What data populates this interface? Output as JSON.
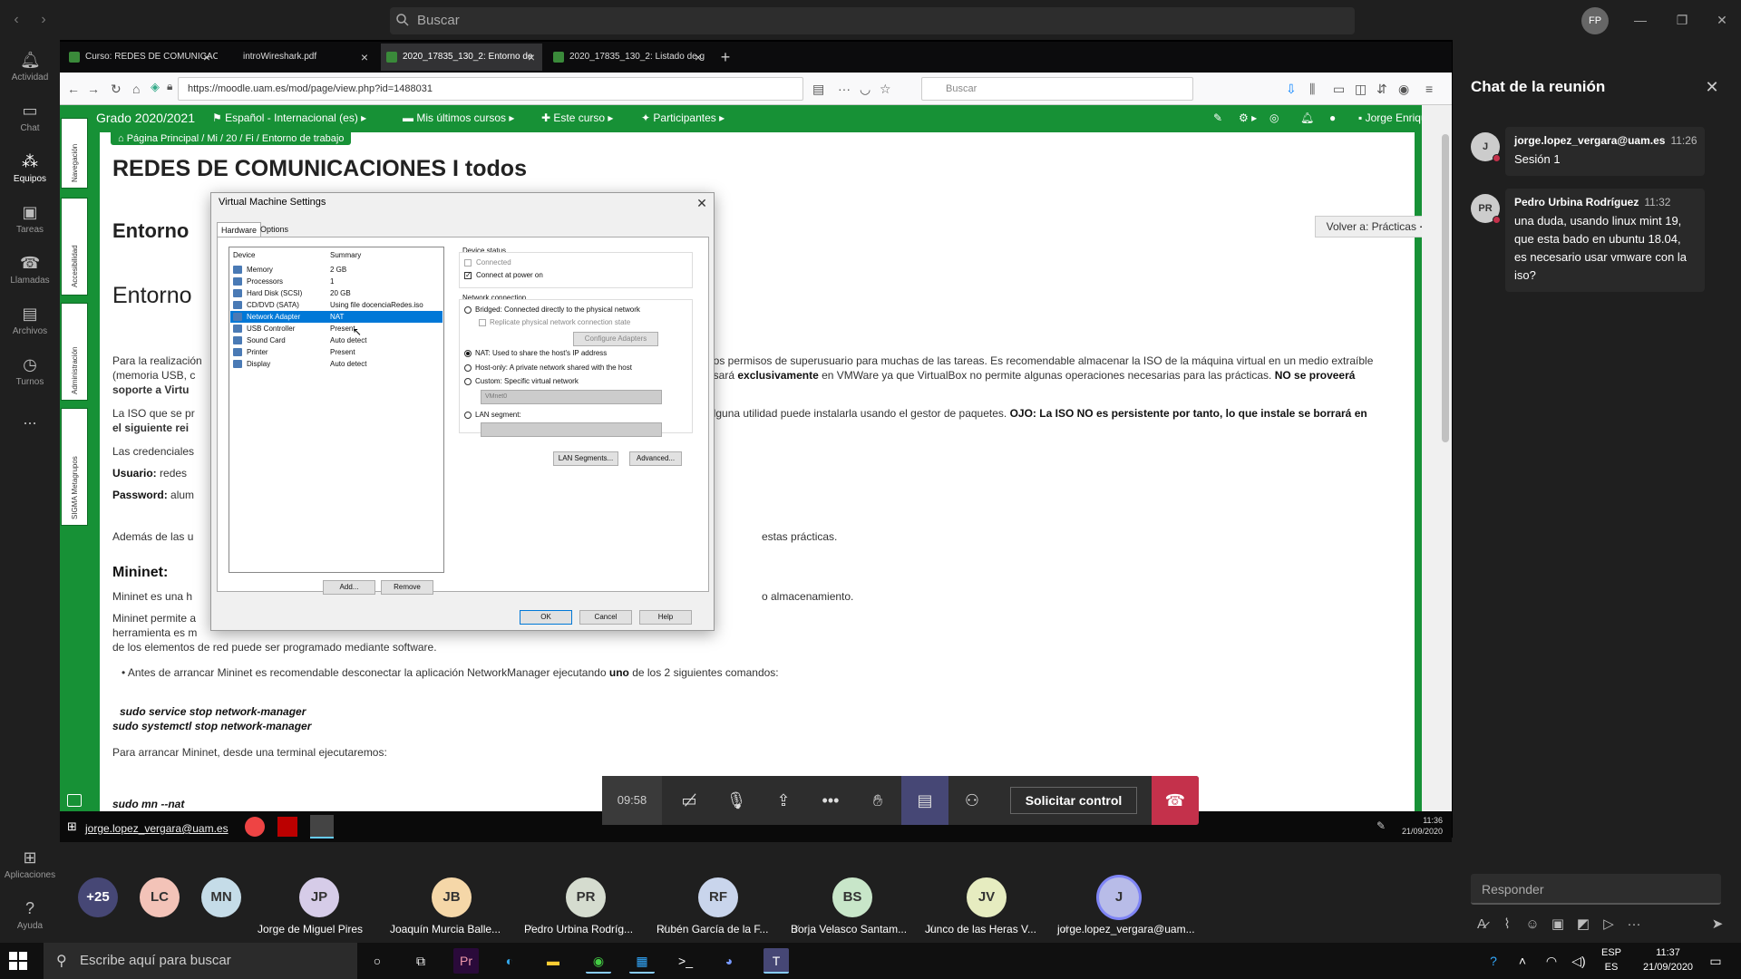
{
  "teams": {
    "search_placeholder": "Buscar",
    "avatar_initials": "FP",
    "rail": [
      {
        "label": "Actividad",
        "icon": "bell-icon"
      },
      {
        "label": "Chat",
        "icon": "chat-icon"
      },
      {
        "label": "Equipos",
        "icon": "teams-icon"
      },
      {
        "label": "Tareas",
        "icon": "assignments-icon"
      },
      {
        "label": "Llamadas",
        "icon": "phone-icon"
      },
      {
        "label": "Archivos",
        "icon": "files-icon"
      },
      {
        "label": "Turnos",
        "icon": "shifts-icon"
      },
      {
        "label": "...",
        "icon": "more-icon"
      },
      {
        "label": "Aplicaciones",
        "icon": "apps-icon"
      },
      {
        "label": "Ayuda",
        "icon": "help-icon"
      }
    ]
  },
  "browser": {
    "tabs": [
      {
        "label": "Curso: REDES DE COMUNICAC"
      },
      {
        "label": "introWireshark.pdf"
      },
      {
        "label": "2020_17835_130_2: Entorno de"
      },
      {
        "label": "2020_17835_130_2: Listado de g"
      }
    ],
    "url": "https://moodle.uam.es/mod/page/view.php?id=1488031",
    "search_placeholder": "Buscar"
  },
  "moodle": {
    "site": "Grado 2020/2021",
    "menu": [
      "Español - Internacional (es) ▸",
      "Mis últimos cursos ▸",
      "Este curso ▸",
      "Participantes ▸"
    ],
    "user": "Jorge Enrique ▸",
    "side_tabs": [
      "Navegación",
      "Accesibilidad",
      "Administración",
      "SIGMA Metagrupos"
    ],
    "breadcrumb": "Página Principal  /  Mi  /  20  /  Fi  /  Entorno de trabajo",
    "h1": "REDES DE COMUNICACIONES I todos",
    "h2a": "Entorno",
    "h2b": "Entorno",
    "back_button": "Volver a: Prácticas ➜",
    "p1a": "Para la realización",
    "p1b": "nos permisos de superusuario para muchas de las tareas. Es recomendable almacenar la ISO de la máquina virtual en un medio extraíble",
    "p1c": "(memoria USB, c",
    "p1d": "usará",
    "p1e": "exclusivamente",
    "p1f": "en VMWare ya que VirtualBox no permite algunas operaciones necesarias para las prácticas.",
    "p1g": "NO se proveerá",
    "p1h": "soporte a Virtu",
    "p2a": "La ISO que se pr",
    "p2b": "alguna utilidad puede instalarla usando el gestor de paquetes.",
    "p2c": "OJO: La ISO NO es persistente por tanto, lo que instale se borrará en",
    "p2d": "el siguiente rei",
    "p3": "Las credenciales",
    "user_label": "Usuario:",
    "user_value": "redes",
    "pass_label": "Password:",
    "pass_value": "alum",
    "p4a": "Además de las u",
    "p4b": "estas prácticas.",
    "mininet_h": "Mininet:",
    "p5a": "Mininet es una h",
    "p5b": "o almacenamiento.",
    "p6a": "Mininet permite a",
    "p6b": "herramienta es m",
    "p6c": "de los elementos de red puede ser programado mediante software.",
    "bullet_a": "Antes de arrancar Mininet es recomendable desconectar la aplicación NetworkManager ejecutando",
    "bullet_b": "uno",
    "bullet_c": "de los 2 siguientes comandos:",
    "cmd1": "sudo service stop network-manager",
    "cmd2": "sudo systemctl stop network-manager",
    "p7": "Para arrancar Mininet, desde una terminal ejecutaremos:",
    "cmd3": "sudo mn --nat"
  },
  "vm_dialog": {
    "title": "Virtual Machine Settings",
    "tabs": [
      "Hardware",
      "Options"
    ],
    "col_device": "Device",
    "col_summary": "Summary",
    "devices": [
      {
        "name": "Memory",
        "summary": "2 GB"
      },
      {
        "name": "Processors",
        "summary": "1"
      },
      {
        "name": "Hard Disk (SCSI)",
        "summary": "20 GB"
      },
      {
        "name": "CD/DVD (SATA)",
        "summary": "Using file docenciaRedes.iso"
      },
      {
        "name": "Network Adapter",
        "summary": "NAT"
      },
      {
        "name": "USB Controller",
        "summary": "Present"
      },
      {
        "name": "Sound Card",
        "summary": "Auto detect"
      },
      {
        "name": "Printer",
        "summary": "Present"
      },
      {
        "name": "Display",
        "summary": "Auto detect"
      }
    ],
    "add": "Add...",
    "remove": "Remove",
    "device_status": "Device status",
    "connected": "Connected",
    "connect_power": "Connect at power on",
    "net_conn": "Network connection",
    "bridged": "Bridged: Connected directly to the physical network",
    "replicate": "Replicate physical network connection state",
    "configure": "Configure Adapters",
    "nat": "NAT: Used to share the host's IP address",
    "hostonly": "Host-only: A private network shared with the host",
    "custom": "Custom: Specific virtual network",
    "vmnet": "VMnet0",
    "lanseg": "LAN segment:",
    "lan_btn": "LAN Segments...",
    "adv_btn": "Advanced...",
    "ok": "OK",
    "cancel": "Cancel",
    "help": "Help"
  },
  "guest_taskbar": {
    "user": "jorge.lopez_vergara@uam.es",
    "time": "11:36",
    "date": "21/09/2020"
  },
  "meeting": {
    "timer": "09:58",
    "request_control": "Solicitar control"
  },
  "participants": [
    {
      "initials": "+25",
      "name": "",
      "color": "#464775"
    },
    {
      "initials": "LC",
      "name": "",
      "color": "#f3c3b8"
    },
    {
      "initials": "MN",
      "name": "",
      "color": "#c5dce8"
    },
    {
      "initials": "JP",
      "name": "Jorge de Miguel Pires",
      "color": "#d6cce8"
    },
    {
      "initials": "JB",
      "name": "Joaquín Murcia Balle...",
      "color": "#f5d7a8"
    },
    {
      "initials": "PR",
      "name": "Pedro Urbina Rodríg...",
      "color": "#d5dccf"
    },
    {
      "initials": "RF",
      "name": "Rubén García de la F...",
      "color": "#c9d5ec"
    },
    {
      "initials": "BS",
      "name": "Borja Velasco Santam...",
      "color": "#c8e6c9"
    },
    {
      "initials": "JV",
      "name": "Junco de las Heras V...",
      "color": "#e6ecc0"
    },
    {
      "initials": "J",
      "name": "jorge.lopez_vergara@uam...",
      "color": "#b8bce8"
    }
  ],
  "chat": {
    "title": "Chat de la reunión",
    "messages": [
      {
        "initials": "J",
        "author": "jorge.lopez_vergara@uam.es",
        "time": "11:26",
        "body": "Sesión 1"
      },
      {
        "initials": "PR",
        "author": "Pedro Urbina Rodríguez",
        "time": "11:32",
        "body": "una duda, usando linux mint 19, que esta bado en ubuntu 18.04, es necesario usar vmware con la iso?"
      }
    ],
    "input_placeholder": "Responder"
  },
  "host_taskbar": {
    "search_placeholder": "Escribe aquí para buscar",
    "lang": "ESP",
    "lang2": "ES",
    "time": "11:37",
    "date": "21/09/2020"
  },
  "colors": {
    "moodle_green": "#179136",
    "teams_accent": "#464775",
    "hangup_red": "#c4314b"
  }
}
